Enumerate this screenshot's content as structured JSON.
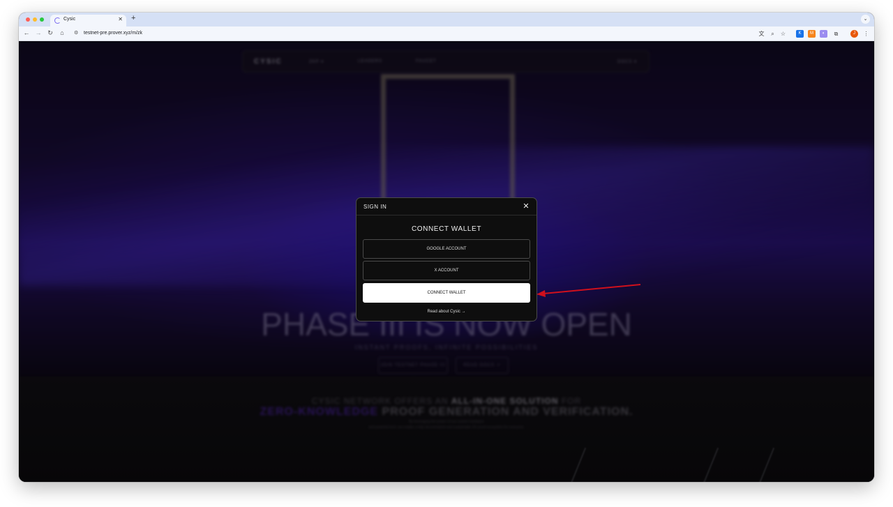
{
  "browser": {
    "tab_title": "Cysic",
    "tab_close": "✕",
    "new_tab": "+",
    "tab_menu": "⌄",
    "url": "testnet-pre.prover.xyz/m/zk",
    "avatar_initial": "J"
  },
  "site": {
    "logo": "CYSIC",
    "nav_links": [
      "ZKP ▾",
      "LEADERS",
      "FAUCET"
    ],
    "nav_right": "DOCS ▾",
    "headline": "PHASE III IS NOW OPEN",
    "subheadline": "INSTANT PROOFS, INFINITE POSSIBILITIES",
    "hero_buttons": [
      "JOIN TESTNET PHASE III ↗",
      "READ DOCS ↗"
    ],
    "section2": {
      "line1_prefix": "CYSIC NETWORK OFFERS AN ",
      "line1_bold": "ALL-IN-ONE SOLUTION",
      "line1_suffix": " FOR",
      "line2_purple": "ZERO-KNOWLEDGE",
      "line2_rest": " PROOF GENERATION AND VERIFICATION.",
      "small1": "By leveraging the power of our custom hardware",
      "small2": "and powerful tech, we enable a fully decentralized and sustainable ZK proof ecosystem for everyone."
    }
  },
  "modal": {
    "title": "SIGN IN",
    "close": "✕",
    "heading": "CONNECT WALLET",
    "options": [
      "GOOGLE ACCOUNT",
      "X ACCOUNT",
      "CONNECT WALLET"
    ],
    "read_link": "Read about Cysic",
    "read_link_arrow": "→"
  },
  "annotation": {
    "arrow_color": "#d0101c"
  }
}
